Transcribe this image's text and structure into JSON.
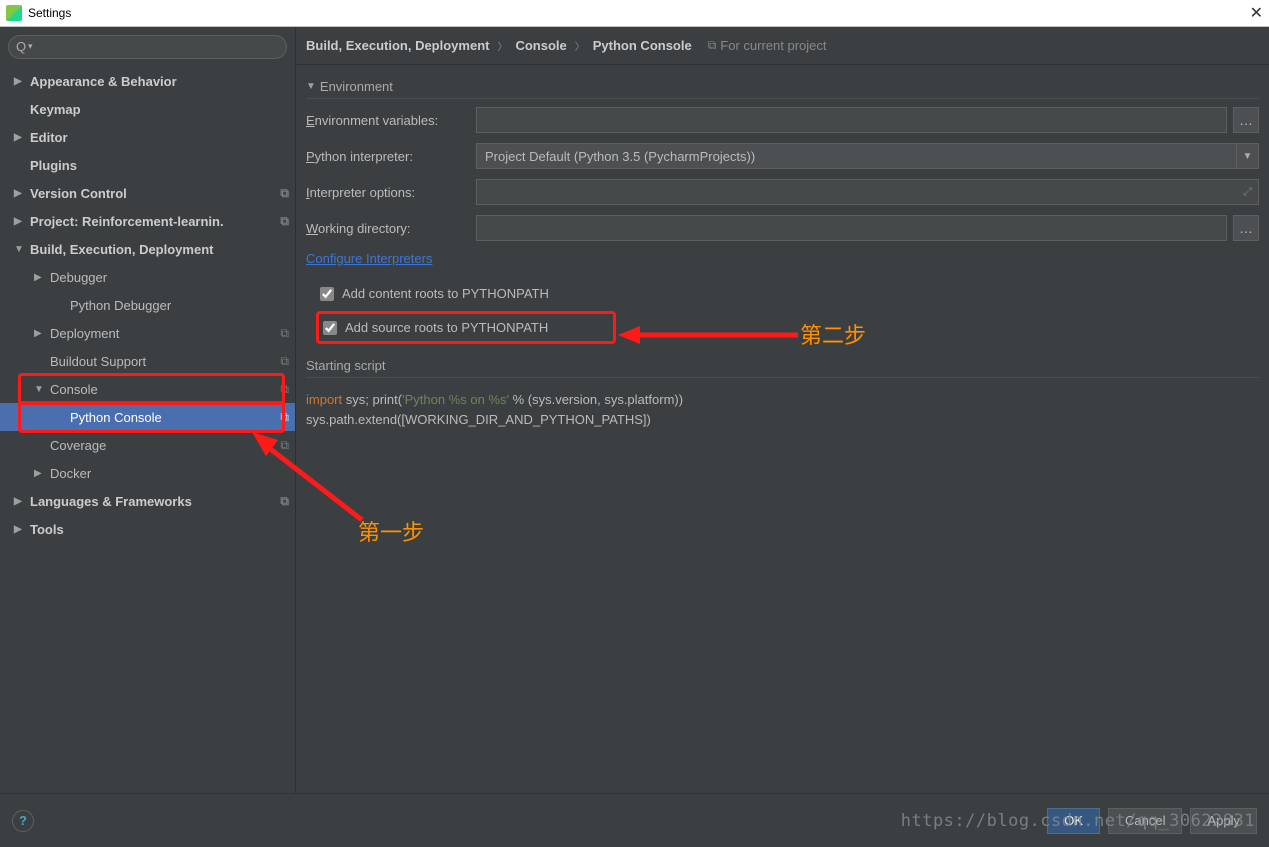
{
  "window": {
    "title": "Settings"
  },
  "sidebar": {
    "search_placeholder": "",
    "items": [
      {
        "label": "Appearance & Behavior",
        "bold": true,
        "expand": "▶"
      },
      {
        "label": "Keymap",
        "bold": true
      },
      {
        "label": "Editor",
        "bold": true,
        "expand": "▶"
      },
      {
        "label": "Plugins",
        "bold": true
      },
      {
        "label": "Version Control",
        "bold": true,
        "expand": "▶",
        "badge": "⧉"
      },
      {
        "label": "Project: Reinforcement-learnin.",
        "bold": true,
        "expand": "▶",
        "badge": "⧉"
      },
      {
        "label": "Build, Execution, Deployment",
        "bold": true,
        "expand": "▼"
      },
      {
        "label": "Debugger",
        "expand": "▶"
      },
      {
        "label": "Python Debugger"
      },
      {
        "label": "Deployment",
        "expand": "▶",
        "badge": "⧉"
      },
      {
        "label": "Buildout Support",
        "badge": "⧉"
      },
      {
        "label": "Console",
        "expand": "▼",
        "badge": "⧉"
      },
      {
        "label": "Python Console",
        "badge": "⧉"
      },
      {
        "label": "Coverage",
        "badge": "⧉"
      },
      {
        "label": "Docker",
        "expand": "▶"
      },
      {
        "label": "Languages & Frameworks",
        "bold": true,
        "expand": "▶",
        "badge": "⧉"
      },
      {
        "label": "Tools",
        "bold": true,
        "expand": "▶"
      }
    ]
  },
  "breadcrumb": {
    "parts": [
      "Build, Execution, Deployment",
      "Console",
      "Python Console"
    ],
    "meta": "For current project"
  },
  "form": {
    "env_section": "Environment",
    "env_vars_label": "Environment variables:",
    "interpreter_label": "Python interpreter:",
    "interpreter_value": "Project Default (Python 3.5 (PycharmProjects))",
    "interpreter_opts_label": "Interpreter options:",
    "working_dir_label": "Working directory:",
    "config_link": "Configure Interpreters",
    "cb_content": "Add content roots to PYTHONPATH",
    "cb_source": "Add source roots to PYTHONPATH",
    "starting": "Starting script",
    "code": {
      "import": "import",
      "sys1": " sys; ",
      "print": "print",
      "str": "'Python %s on %s'",
      "rest1": " % (sys.version, sys.platform))",
      "line2": "sys.path.extend([WORKING_DIR_AND_PYTHON_PATHS])"
    }
  },
  "annotations": {
    "step1": "第一步",
    "step2": "第二步"
  },
  "footer": {
    "ok": "OK",
    "cancel": "Cancel",
    "apply": "Apply"
  },
  "watermark": "https://blog.csdn.net/qq_30622831"
}
